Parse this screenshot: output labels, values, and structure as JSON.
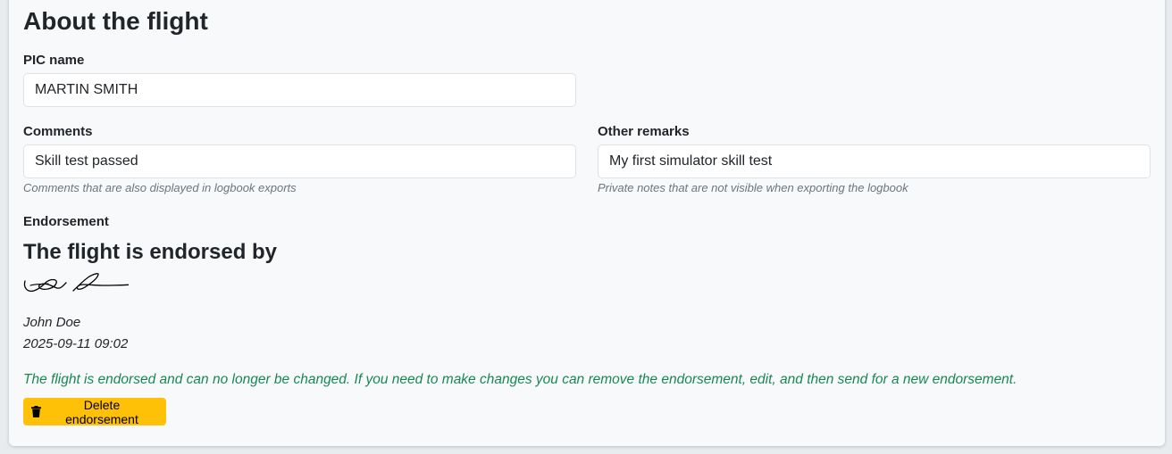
{
  "section": {
    "title": "About the flight"
  },
  "pic": {
    "label": "PIC name",
    "value": "MARTIN SMITH"
  },
  "comments": {
    "label": "Comments",
    "value": "Skill test passed",
    "help": "Comments that are also displayed in logbook exports"
  },
  "remarks": {
    "label": "Other remarks",
    "value": "My first simulator skill test",
    "help": "Private notes that are not visible when exporting the logbook"
  },
  "endorsement": {
    "label": "Endorsement",
    "heading": "The flight is endorsed by",
    "signer": "John Doe",
    "timestamp": "2025-09-11 09:02",
    "notice": "The flight is endorsed and can no longer be changed. If you need to make changes you can remove the endorsement, edit, and then send for a new endorsement.",
    "delete_label": "Delete endorsement",
    "delete_icon": "trash-icon"
  },
  "colors": {
    "notice": "#198754",
    "warning_button": "#ffc107"
  }
}
